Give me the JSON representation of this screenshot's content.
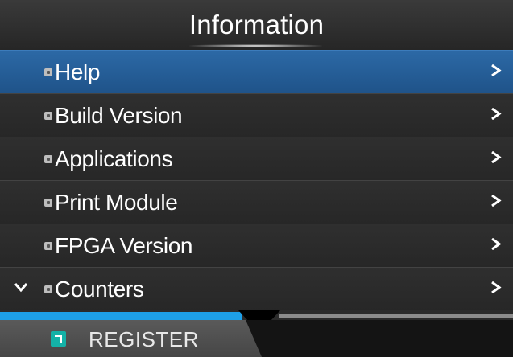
{
  "header": {
    "title": "Information"
  },
  "menu": {
    "items": [
      {
        "label": "Help"
      },
      {
        "label": "Build Version"
      },
      {
        "label": "Applications"
      },
      {
        "label": "Print Module"
      },
      {
        "label": "FPGA Version"
      },
      {
        "label": "Counters"
      }
    ],
    "selected_index": 0
  },
  "footer": {
    "register_label": "REGISTER"
  },
  "colors": {
    "selected_row": "#2364a0",
    "progress_bar": "#1ea0e8",
    "register_icon": "#14b1a7"
  },
  "icons": {
    "item_icon": "item-icon",
    "chevron": "chevron-right-icon",
    "expand": "chevron-down-icon",
    "register": "register-icon"
  }
}
